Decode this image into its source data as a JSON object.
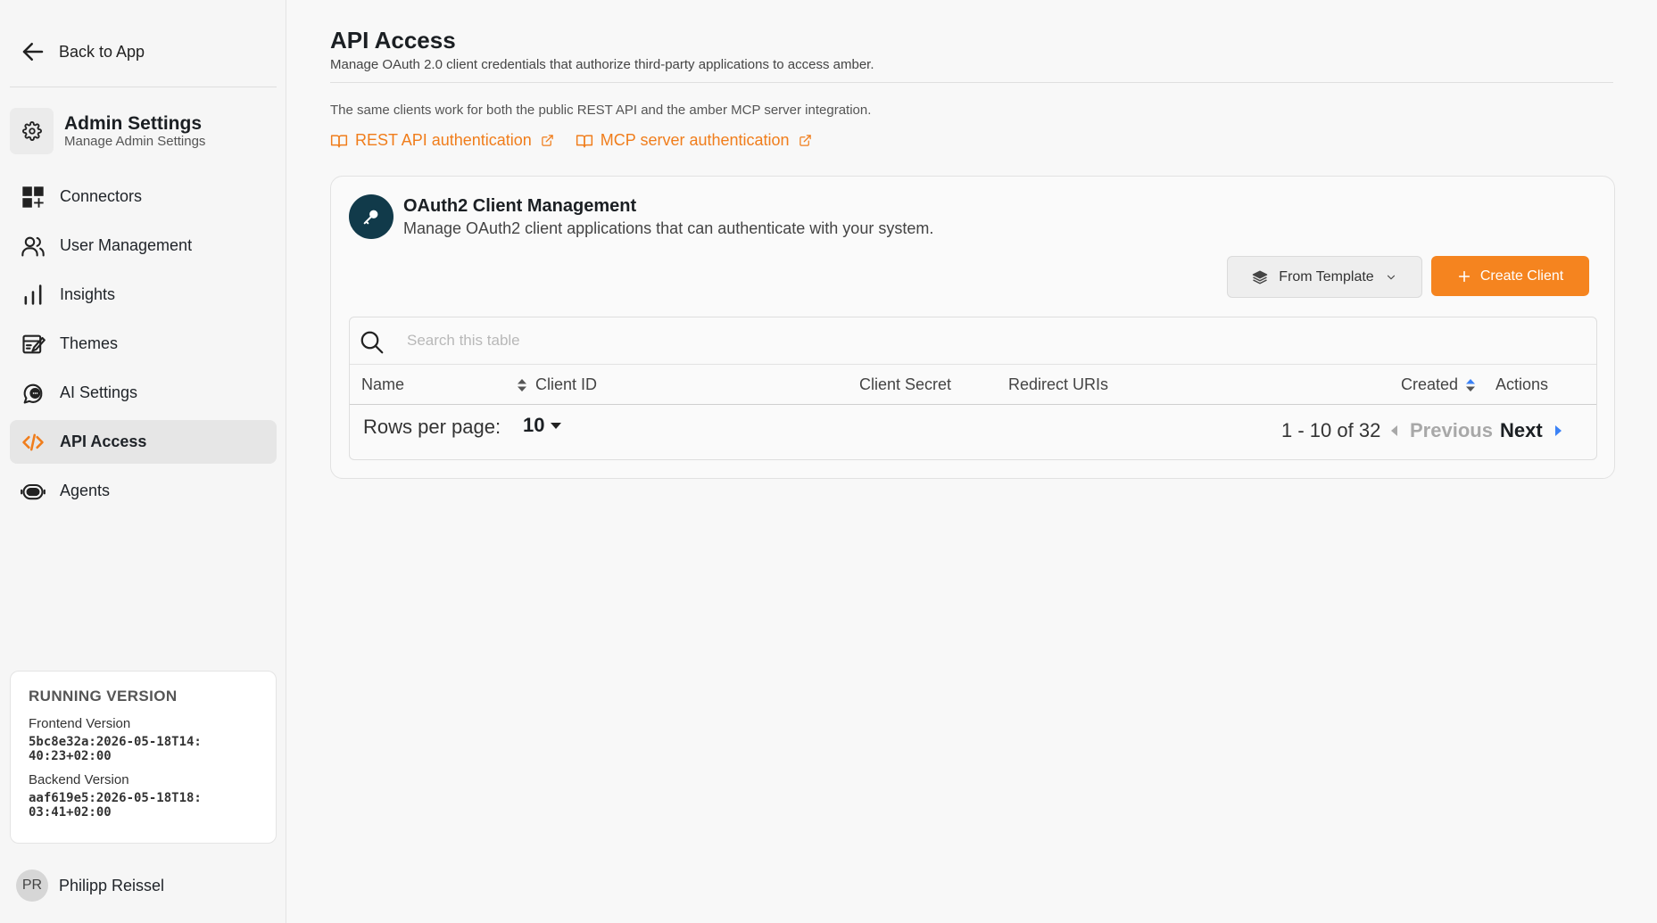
{
  "sidebar": {
    "back_label": "Back to App",
    "admin_title": "Admin Settings",
    "admin_subtitle": "Manage Admin Settings",
    "items": [
      {
        "label": "Connectors",
        "icon": "grid-plus-icon",
        "active": false
      },
      {
        "label": "User Management",
        "icon": "users-icon",
        "active": false
      },
      {
        "label": "Insights",
        "icon": "bar-chart-icon",
        "active": false
      },
      {
        "label": "Themes",
        "icon": "palette-icon",
        "active": false
      },
      {
        "label": "AI Settings",
        "icon": "ai-chat-icon",
        "active": false
      },
      {
        "label": "API Access",
        "icon": "code-icon",
        "active": true
      },
      {
        "label": "Agents",
        "icon": "robot-icon",
        "active": false
      }
    ],
    "version": {
      "title": "RUNNING VERSION",
      "frontend_label": "Frontend Version",
      "frontend_value": "5bc8e32a:2026-05-18T14:40:23+02:00",
      "backend_label": "Backend Version",
      "backend_value": "aaf619e5:2026-05-18T18:03:41+02:00"
    },
    "user": {
      "initials": "PR",
      "name": "Philipp Reissel"
    }
  },
  "main": {
    "title": "API Access",
    "subtitle": "Manage OAuth 2.0 client credentials that authorize third-party applications to access amber.",
    "info": "The same clients work for both the public REST API and the amber MCP server integration.",
    "links": [
      {
        "label": "REST API authentication"
      },
      {
        "label": "MCP server authentication"
      }
    ],
    "card": {
      "title": "OAuth2 Client Management",
      "subtitle": "Manage OAuth2 client applications that can authenticate with your system.",
      "template_button": "From Template",
      "create_button": "Create Client"
    },
    "table": {
      "search_placeholder": "Search this table",
      "columns": [
        "Name",
        "Client ID",
        "Client Secret",
        "Redirect URIs",
        "Created",
        "Actions"
      ],
      "rows_per_page_label": "Rows per page:",
      "rows_per_page_value": "10",
      "range": "1 - 10 of 32",
      "previous": "Previous",
      "next": "Next"
    }
  },
  "colors": {
    "accent": "#f5841f",
    "link": "#f07d1b",
    "key_badge": "#113a4a",
    "sort_active": "#3b82f6"
  }
}
